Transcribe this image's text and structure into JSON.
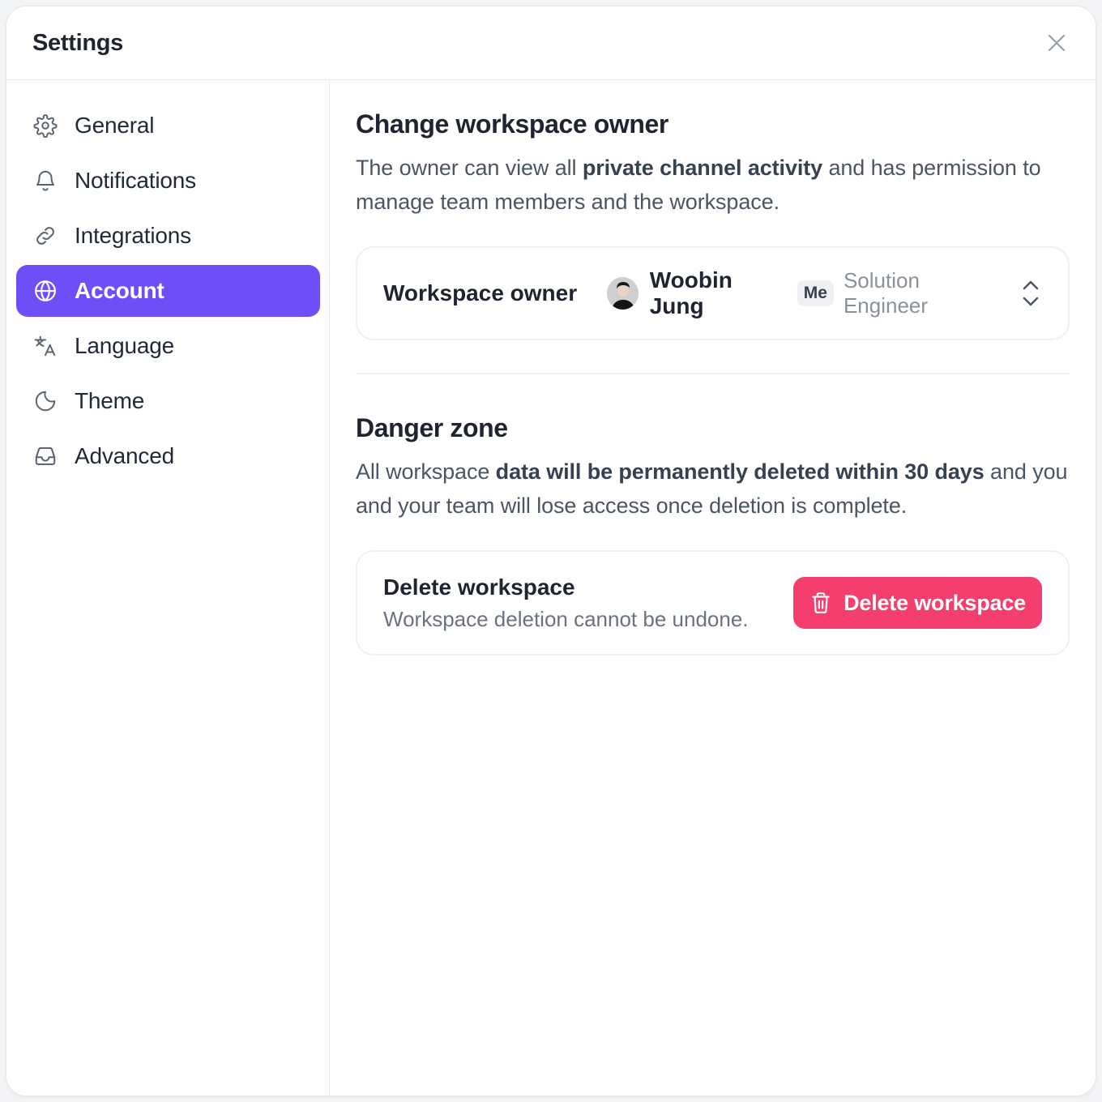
{
  "header": {
    "title": "Settings"
  },
  "sidebar": {
    "items": [
      {
        "label": "General",
        "icon": "gear-icon",
        "active": false
      },
      {
        "label": "Notifications",
        "icon": "bell-icon",
        "active": false
      },
      {
        "label": "Integrations",
        "icon": "link-icon",
        "active": false
      },
      {
        "label": "Account",
        "icon": "globe-icon",
        "active": true
      },
      {
        "label": "Language",
        "icon": "translate-icon",
        "active": false
      },
      {
        "label": "Theme",
        "icon": "moon-icon",
        "active": false
      },
      {
        "label": "Advanced",
        "icon": "inbox-icon",
        "active": false
      }
    ]
  },
  "owner_section": {
    "title": "Change workspace owner",
    "desc_pre": "The owner can view all ",
    "desc_bold": "private channel activity",
    "desc_post": " and has permission to manage team members and the workspace.",
    "card_label": "Workspace owner",
    "owner_name": "Woobin Jung",
    "owner_badge": "Me",
    "owner_role": "Solution Engineer"
  },
  "danger_section": {
    "title": "Danger zone",
    "desc_pre": "All workspace ",
    "desc_bold": "data will be permanently deleted within 30 days",
    "desc_post": " and you and your team will lose access once deletion is complete.",
    "card_title": "Delete workspace",
    "card_subtitle": "Workspace deletion cannot be undone.",
    "button_label": "Delete workspace"
  },
  "colors": {
    "accent": "#6d4ef7",
    "danger": "#f43f6e"
  }
}
